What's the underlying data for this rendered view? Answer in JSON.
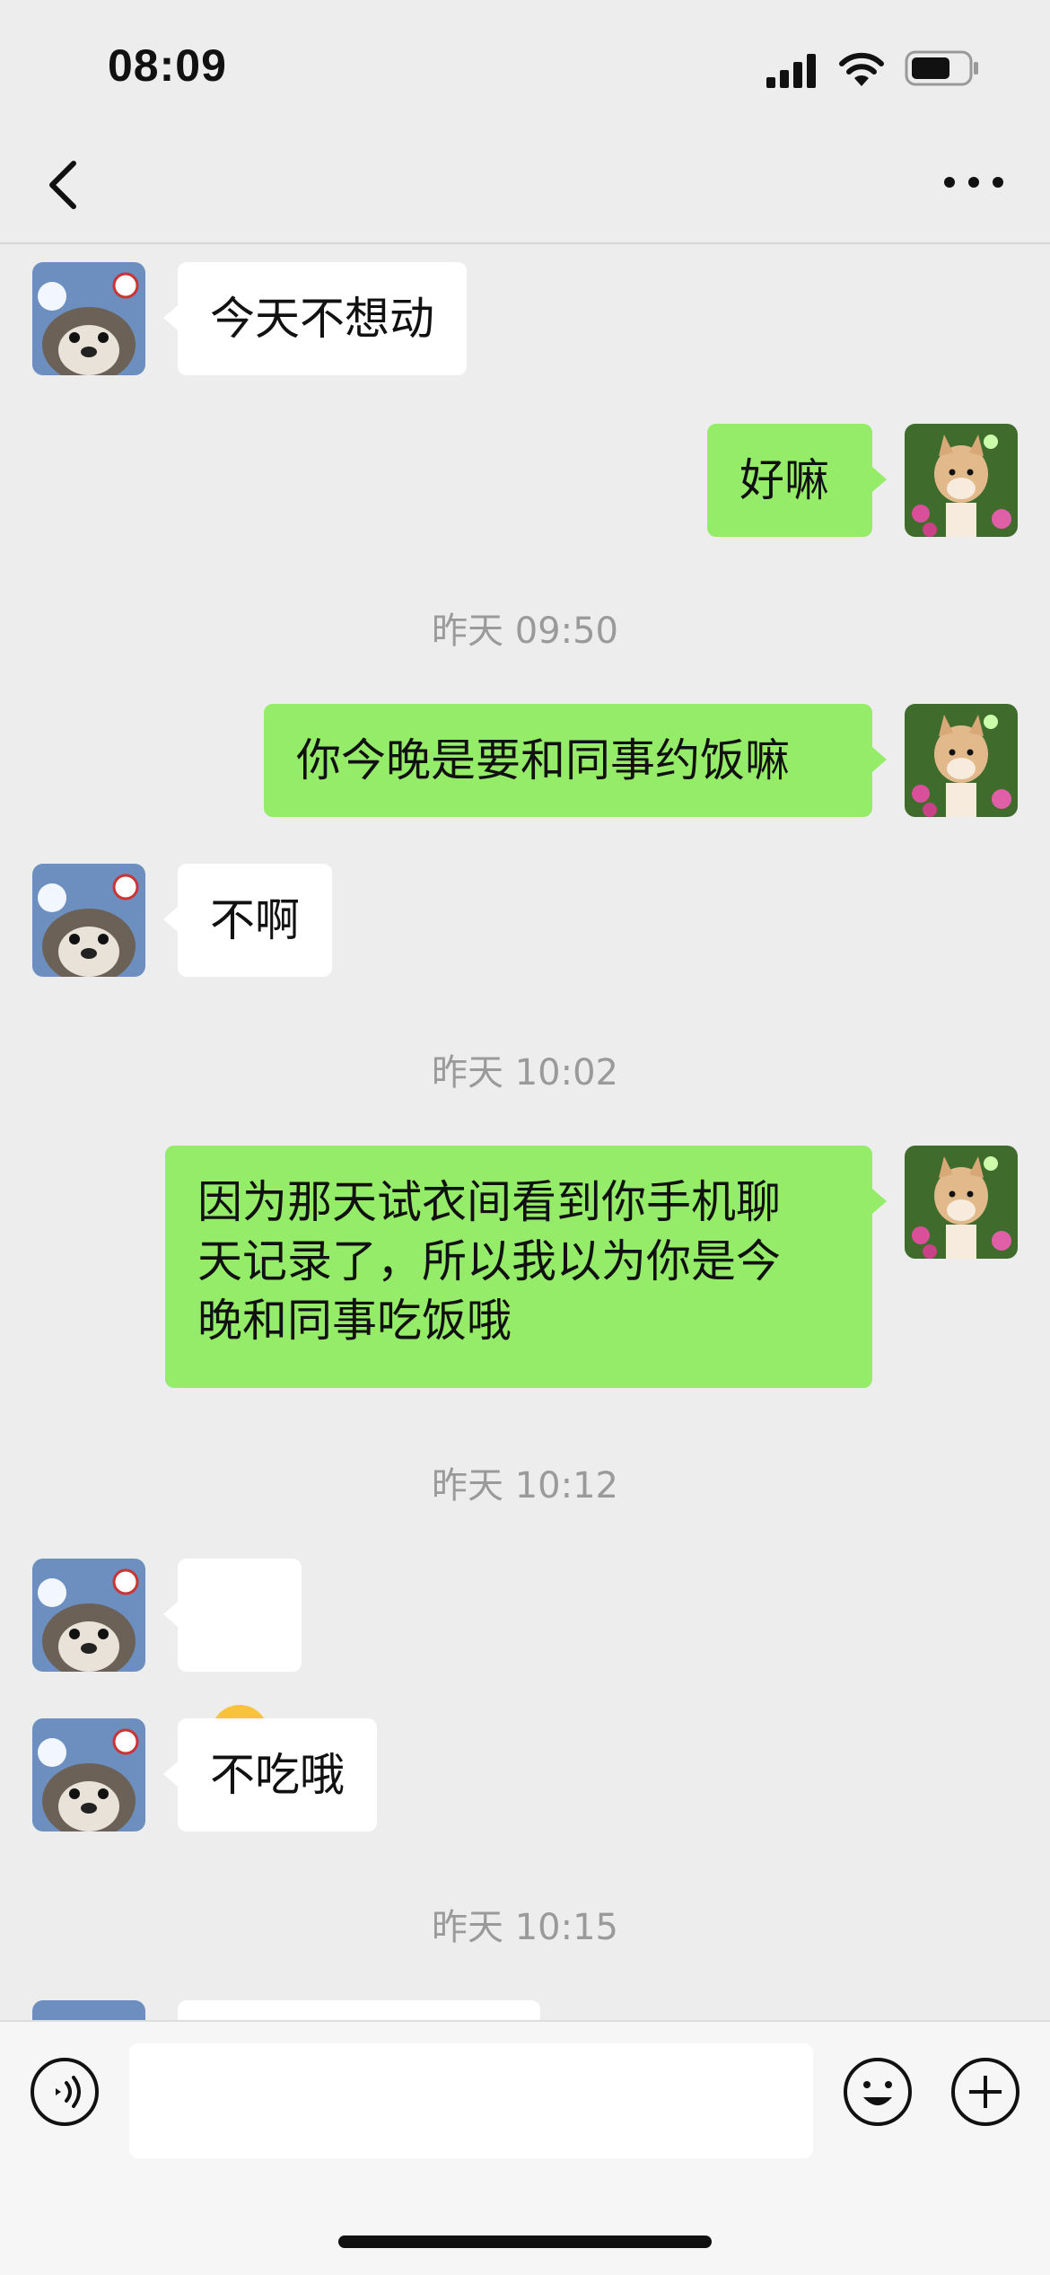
{
  "status_bar": {
    "time": "08:09"
  },
  "nav": {
    "back_icon": "chevron-left-icon",
    "more_icon": "more-dots-icon"
  },
  "messages": [
    {
      "side": "in",
      "text": "今天不想动"
    },
    {
      "side": "out",
      "text": "好嘛"
    },
    {
      "type": "time",
      "text": "昨天 09:50"
    },
    {
      "side": "out",
      "text": "你今晚是要和同事约饭嘛"
    },
    {
      "side": "in",
      "text": "不啊"
    },
    {
      "type": "time",
      "text": "昨天 10:02"
    },
    {
      "side": "out",
      "text": "因为那天试衣间看到你手机聊\n天记录了，所以我以为你是今\n晚和同事吃饭哦"
    },
    {
      "type": "time",
      "text": "昨天 10:12"
    },
    {
      "side": "in",
      "text": "🤫"
    },
    {
      "side": "in",
      "text": "不吃哦"
    },
    {
      "type": "time",
      "text": "昨天 10:15"
    }
  ],
  "input_bar": {
    "placeholder": "",
    "voice_icon": "voice-icon",
    "emoji_icon": "emoji-icon",
    "plus_icon": "plus-icon"
  },
  "colors": {
    "background": "#EDEDED",
    "outgoing_bubble": "#95EC69",
    "incoming_bubble": "#FFFFFF",
    "timestamp": "#9A9A9A"
  }
}
